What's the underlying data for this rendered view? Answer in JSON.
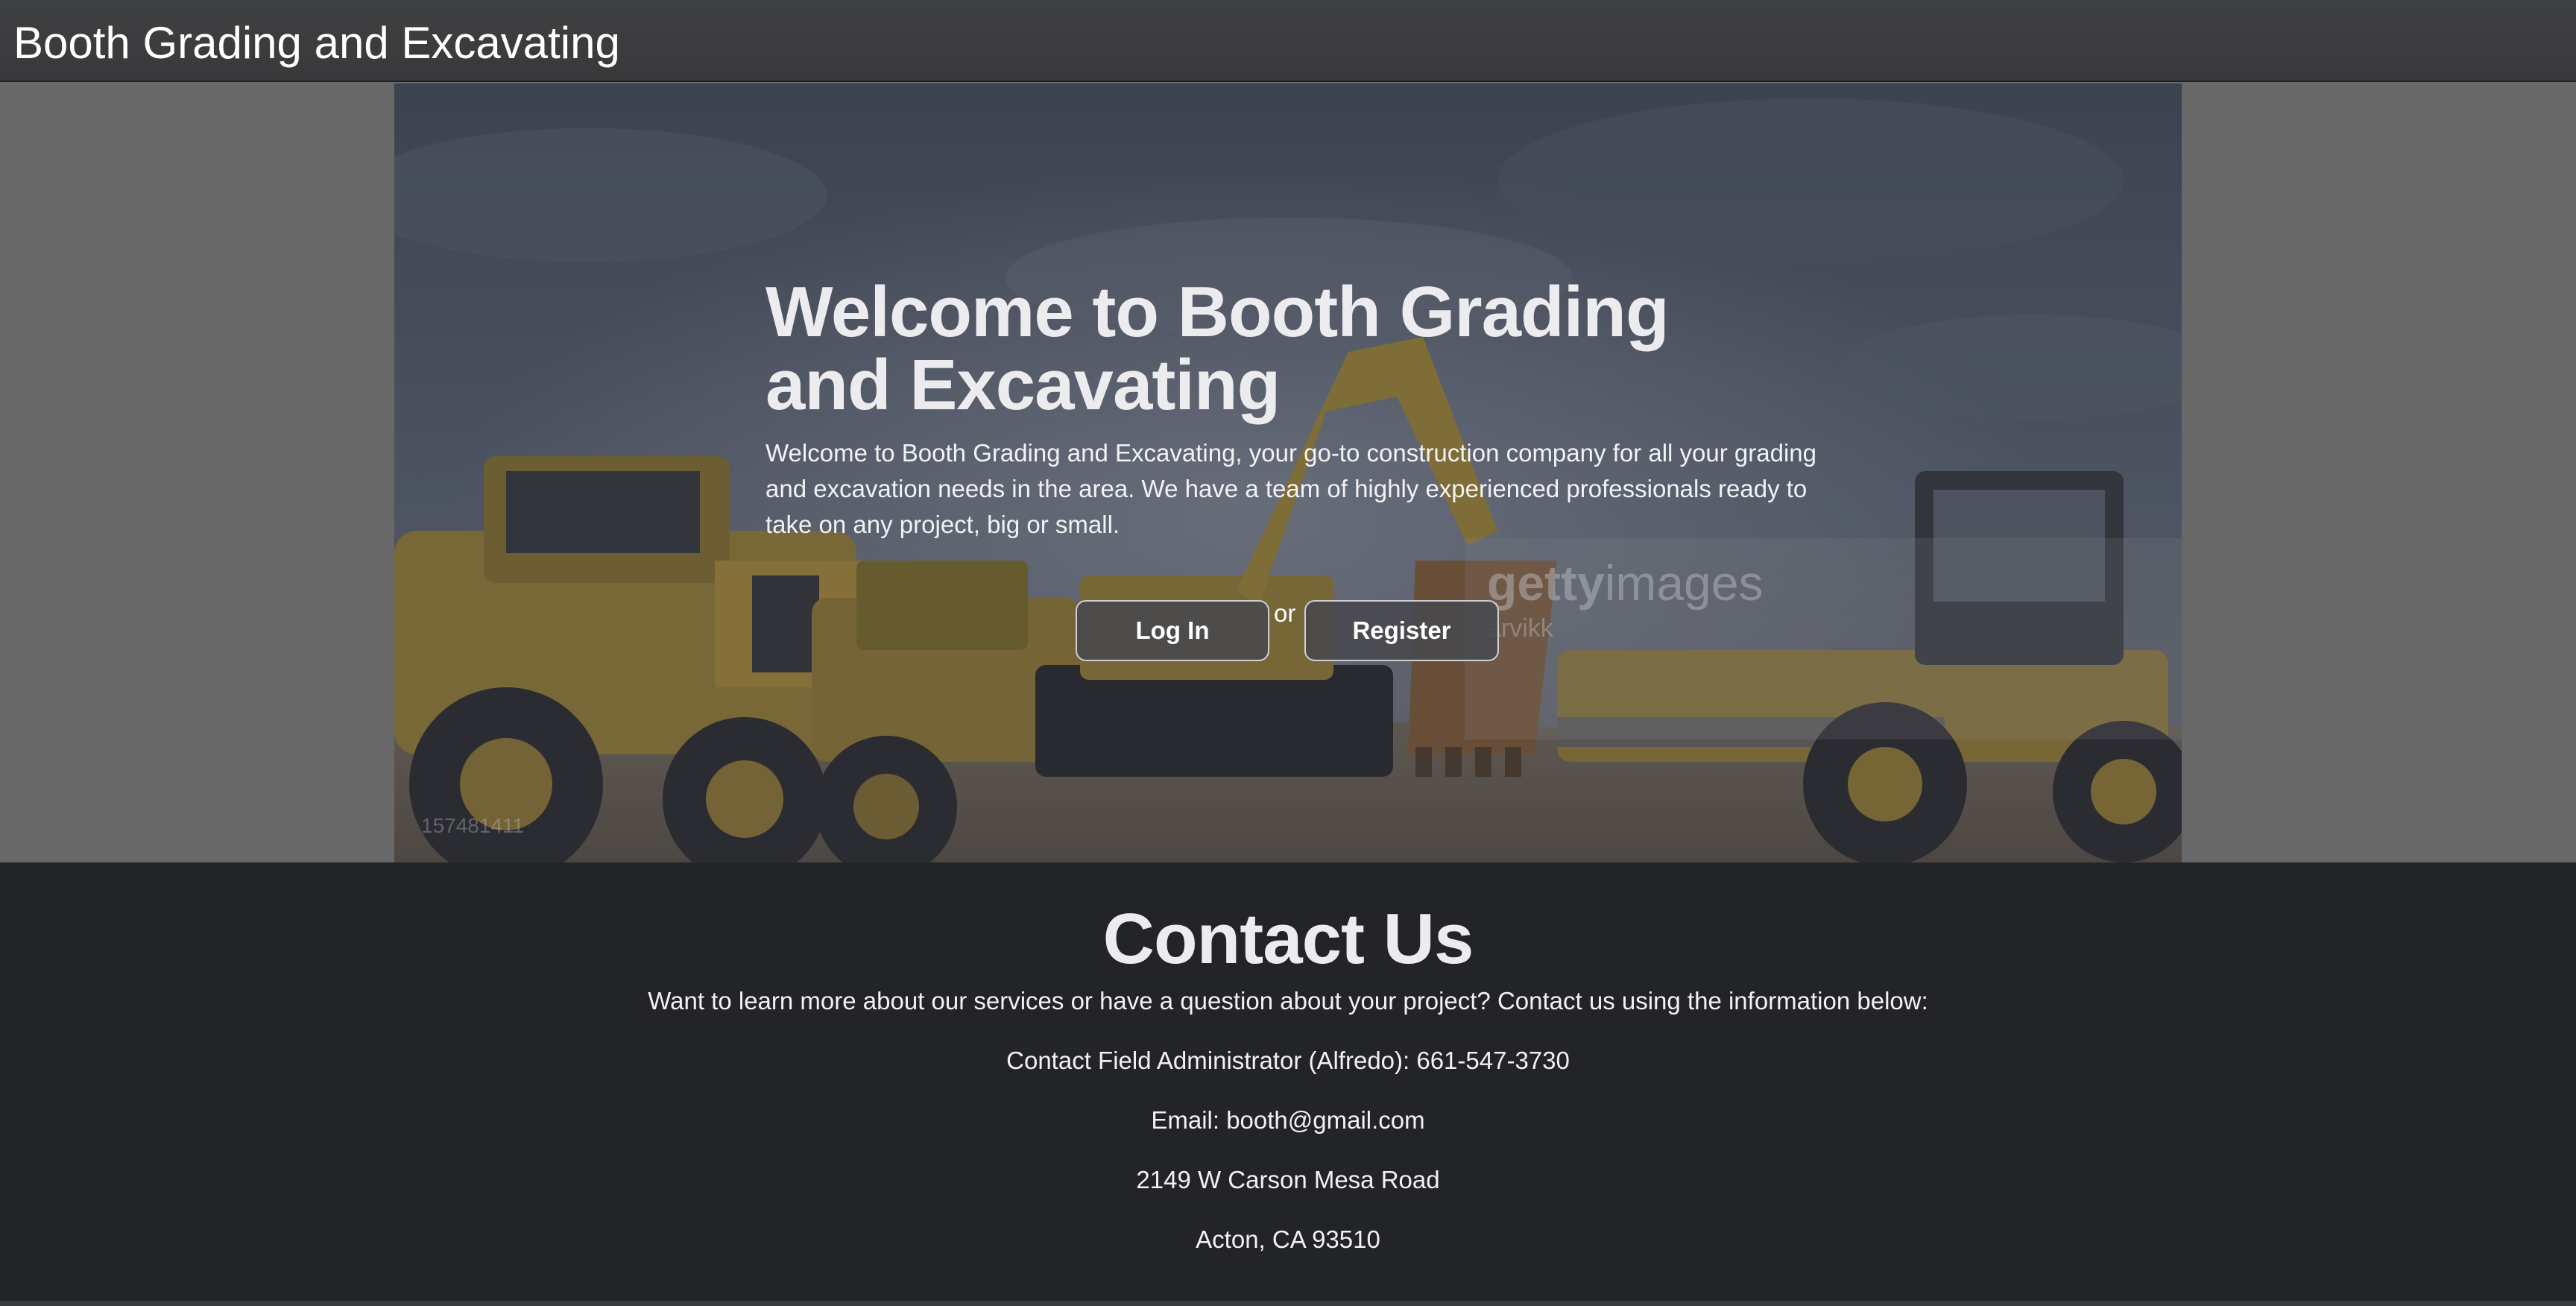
{
  "navbar": {
    "brand": "Booth Grading and Excavating"
  },
  "hero": {
    "title": "Welcome to Booth Grading and Excavating",
    "description": "Welcome to Booth Grading and Excavating, your go-to construction company for all your grading and excavation needs in the area. We have a team of highly experienced professionals ready to take on any project, big or small.",
    "login_label": "Log In",
    "separator": "or",
    "register_label": "Register",
    "image": {
      "watermark_logo_bold": "getty",
      "watermark_logo_light": "images",
      "watermark_credit": "arvikk",
      "stock_id": "157481411"
    }
  },
  "contact": {
    "title": "Contact Us",
    "intro": "Want to learn more about our services or have a question about your project? Contact us using the information below:",
    "phone_line": "Contact Field Administrator (Alfredo): 661-547-3730",
    "email_line": "Email: booth@gmail.com",
    "address_street": "2149 W Carson Mesa Road",
    "address_city": "Acton, CA 93510"
  },
  "colors": {
    "navbar_bg": "#3f4042",
    "side_bg": "#686868",
    "contact_bg": "#232427",
    "text": "#f2f2f4",
    "machinery_yellow": "#c9a23a"
  }
}
